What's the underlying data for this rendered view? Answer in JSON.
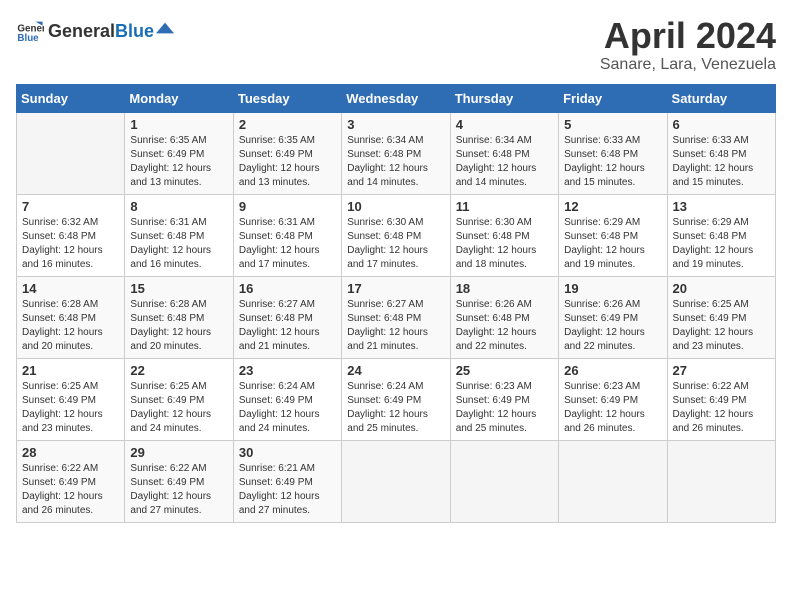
{
  "header": {
    "logo_general": "General",
    "logo_blue": "Blue",
    "month": "April 2024",
    "location": "Sanare, Lara, Venezuela"
  },
  "days_of_week": [
    "Sunday",
    "Monday",
    "Tuesday",
    "Wednesday",
    "Thursday",
    "Friday",
    "Saturday"
  ],
  "weeks": [
    [
      {
        "day": "",
        "sunrise": "",
        "sunset": "",
        "daylight": ""
      },
      {
        "day": "1",
        "sunrise": "6:35 AM",
        "sunset": "6:49 PM",
        "daylight": "12 hours and 13 minutes."
      },
      {
        "day": "2",
        "sunrise": "6:35 AM",
        "sunset": "6:49 PM",
        "daylight": "12 hours and 13 minutes."
      },
      {
        "day": "3",
        "sunrise": "6:34 AM",
        "sunset": "6:48 PM",
        "daylight": "12 hours and 14 minutes."
      },
      {
        "day": "4",
        "sunrise": "6:34 AM",
        "sunset": "6:48 PM",
        "daylight": "12 hours and 14 minutes."
      },
      {
        "day": "5",
        "sunrise": "6:33 AM",
        "sunset": "6:48 PM",
        "daylight": "12 hours and 15 minutes."
      },
      {
        "day": "6",
        "sunrise": "6:33 AM",
        "sunset": "6:48 PM",
        "daylight": "12 hours and 15 minutes."
      }
    ],
    [
      {
        "day": "7",
        "sunrise": "6:32 AM",
        "sunset": "6:48 PM",
        "daylight": "12 hours and 16 minutes."
      },
      {
        "day": "8",
        "sunrise": "6:31 AM",
        "sunset": "6:48 PM",
        "daylight": "12 hours and 16 minutes."
      },
      {
        "day": "9",
        "sunrise": "6:31 AM",
        "sunset": "6:48 PM",
        "daylight": "12 hours and 17 minutes."
      },
      {
        "day": "10",
        "sunrise": "6:30 AM",
        "sunset": "6:48 PM",
        "daylight": "12 hours and 17 minutes."
      },
      {
        "day": "11",
        "sunrise": "6:30 AM",
        "sunset": "6:48 PM",
        "daylight": "12 hours and 18 minutes."
      },
      {
        "day": "12",
        "sunrise": "6:29 AM",
        "sunset": "6:48 PM",
        "daylight": "12 hours and 19 minutes."
      },
      {
        "day": "13",
        "sunrise": "6:29 AM",
        "sunset": "6:48 PM",
        "daylight": "12 hours and 19 minutes."
      }
    ],
    [
      {
        "day": "14",
        "sunrise": "6:28 AM",
        "sunset": "6:48 PM",
        "daylight": "12 hours and 20 minutes."
      },
      {
        "day": "15",
        "sunrise": "6:28 AM",
        "sunset": "6:48 PM",
        "daylight": "12 hours and 20 minutes."
      },
      {
        "day": "16",
        "sunrise": "6:27 AM",
        "sunset": "6:48 PM",
        "daylight": "12 hours and 21 minutes."
      },
      {
        "day": "17",
        "sunrise": "6:27 AM",
        "sunset": "6:48 PM",
        "daylight": "12 hours and 21 minutes."
      },
      {
        "day": "18",
        "sunrise": "6:26 AM",
        "sunset": "6:48 PM",
        "daylight": "12 hours and 22 minutes."
      },
      {
        "day": "19",
        "sunrise": "6:26 AM",
        "sunset": "6:49 PM",
        "daylight": "12 hours and 22 minutes."
      },
      {
        "day": "20",
        "sunrise": "6:25 AM",
        "sunset": "6:49 PM",
        "daylight": "12 hours and 23 minutes."
      }
    ],
    [
      {
        "day": "21",
        "sunrise": "6:25 AM",
        "sunset": "6:49 PM",
        "daylight": "12 hours and 23 minutes."
      },
      {
        "day": "22",
        "sunrise": "6:25 AM",
        "sunset": "6:49 PM",
        "daylight": "12 hours and 24 minutes."
      },
      {
        "day": "23",
        "sunrise": "6:24 AM",
        "sunset": "6:49 PM",
        "daylight": "12 hours and 24 minutes."
      },
      {
        "day": "24",
        "sunrise": "6:24 AM",
        "sunset": "6:49 PM",
        "daylight": "12 hours and 25 minutes."
      },
      {
        "day": "25",
        "sunrise": "6:23 AM",
        "sunset": "6:49 PM",
        "daylight": "12 hours and 25 minutes."
      },
      {
        "day": "26",
        "sunrise": "6:23 AM",
        "sunset": "6:49 PM",
        "daylight": "12 hours and 26 minutes."
      },
      {
        "day": "27",
        "sunrise": "6:22 AM",
        "sunset": "6:49 PM",
        "daylight": "12 hours and 26 minutes."
      }
    ],
    [
      {
        "day": "28",
        "sunrise": "6:22 AM",
        "sunset": "6:49 PM",
        "daylight": "12 hours and 26 minutes."
      },
      {
        "day": "29",
        "sunrise": "6:22 AM",
        "sunset": "6:49 PM",
        "daylight": "12 hours and 27 minutes."
      },
      {
        "day": "30",
        "sunrise": "6:21 AM",
        "sunset": "6:49 PM",
        "daylight": "12 hours and 27 minutes."
      },
      {
        "day": "",
        "sunrise": "",
        "sunset": "",
        "daylight": ""
      },
      {
        "day": "",
        "sunrise": "",
        "sunset": "",
        "daylight": ""
      },
      {
        "day": "",
        "sunrise": "",
        "sunset": "",
        "daylight": ""
      },
      {
        "day": "",
        "sunrise": "",
        "sunset": "",
        "daylight": ""
      }
    ]
  ],
  "labels": {
    "sunrise_prefix": "Sunrise: ",
    "sunset_prefix": "Sunset: ",
    "daylight_prefix": "Daylight: "
  }
}
